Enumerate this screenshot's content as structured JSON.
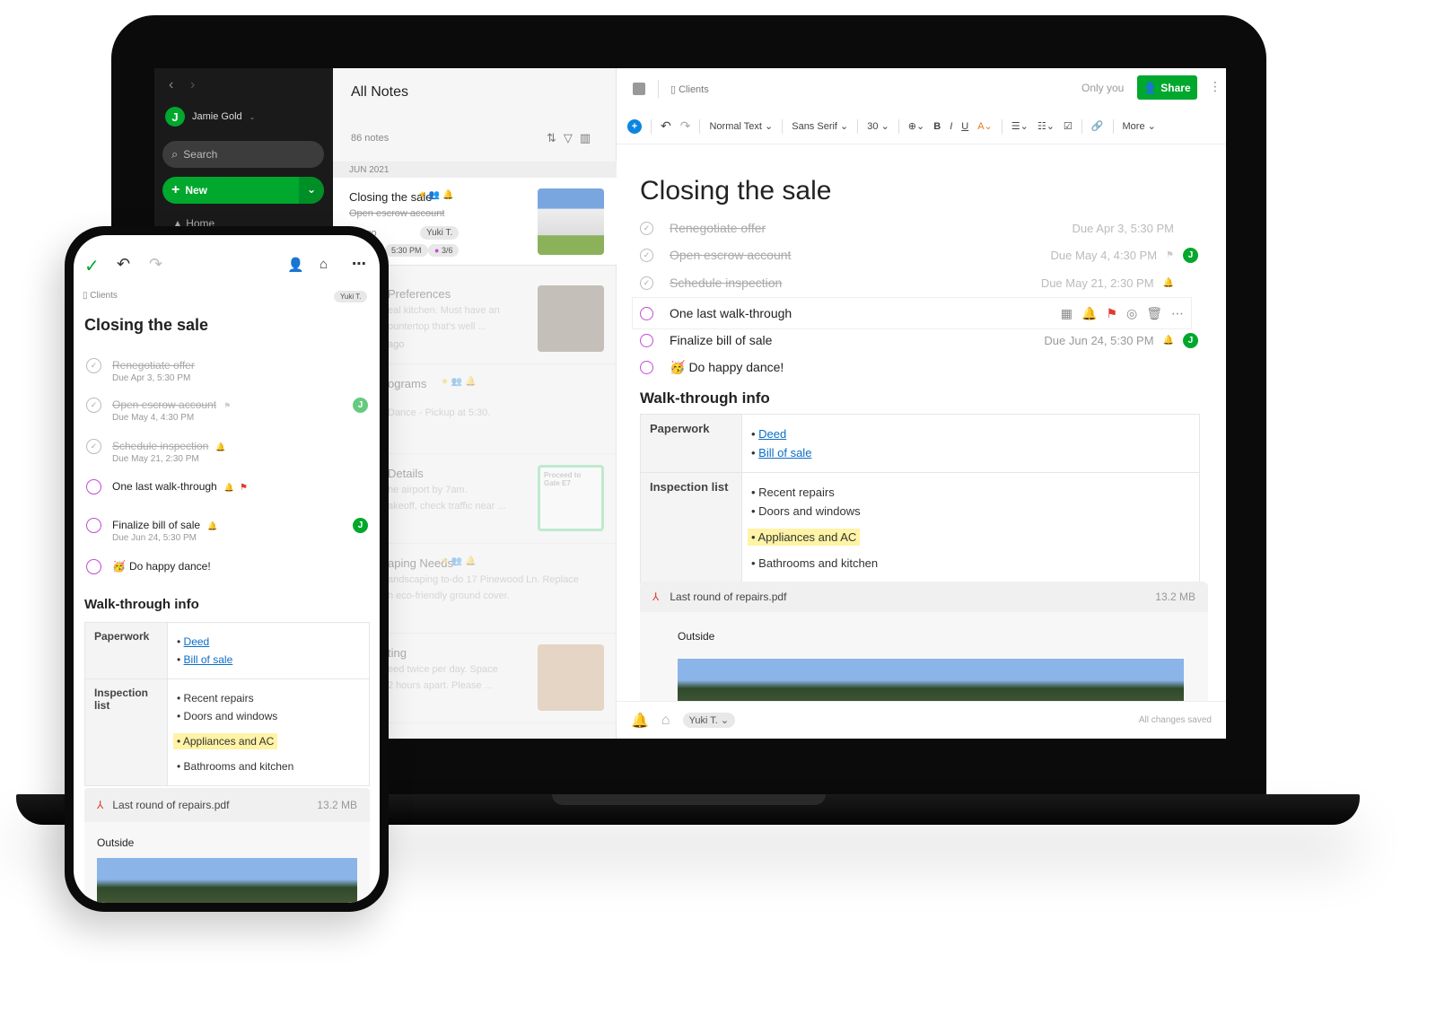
{
  "sidebar": {
    "user": "Jamie Gold",
    "avatar_initial": "J",
    "search_placeholder": "Search",
    "new_label": "New",
    "home_label": "Home"
  },
  "note_list": {
    "title": "All Notes",
    "count": "86 notes",
    "group": "JUN 2021",
    "notes": [
      {
        "title": "Closing the sale",
        "snippet": "Open escrow account",
        "time": "te ago",
        "user": "Yuki T.",
        "reminder": "5:30 PM",
        "tasks": "3/6"
      },
      {
        "title": "Preferences",
        "snippet": "eal kitchen. Must have an",
        "snippet2": "ountertop that's well ...",
        "time": "ago"
      },
      {
        "title": "ograms",
        "snippet": "Dance - Pickup at 5:30."
      },
      {
        "title": "Details",
        "snippet": "he airport by 7am.",
        "snippet2": "akeoff, check traffic near ...",
        "ticket": "Proceed to Gate E7"
      },
      {
        "title": "aping Needs",
        "snippet": "andscaping to-do 17 Pinewood Ln. Replace",
        "snippet2": "h eco-friendly ground cover."
      },
      {
        "title": "ting",
        "snippet": "eed twice per day. Space",
        "snippet2": "2 hours apart. Please ..."
      }
    ]
  },
  "editor": {
    "notebook": "Clients",
    "visibility": "Only you",
    "share_label": "Share",
    "toolbar": {
      "style": "Normal Text",
      "font": "Sans Serif",
      "size": "30",
      "more": "More"
    },
    "title": "Closing the sale",
    "tasks": [
      {
        "text": "Renegotiate offer",
        "done": true,
        "due": "Due Apr 3, 5:30 PM"
      },
      {
        "text": "Open escrow account",
        "done": true,
        "due": "Due May 4, 4:30 PM",
        "flag": true,
        "assignee": "J"
      },
      {
        "text": "Schedule inspection",
        "done": true,
        "due": "Due May 21, 2:30 PM",
        "bell": true
      },
      {
        "text": "One last walk-through",
        "done": false,
        "active": true
      },
      {
        "text": "Finalize bill of sale",
        "done": false,
        "due": "Due Jun 24, 5:30 PM",
        "bell": true,
        "assignee": "J"
      },
      {
        "text": "Do happy dance!",
        "done": false,
        "emoji": "🥳"
      }
    ],
    "section_heading": "Walk-through info",
    "table": {
      "paperwork_label": "Paperwork",
      "paperwork_links": [
        "Deed",
        "Bill of sale"
      ],
      "inspection_label": "Inspection list",
      "inspection_items": [
        "Recent repairs",
        "Doors and windows",
        "Appliances and AC",
        "Bathrooms and kitchen"
      ],
      "highlighted": "Appliances and AC"
    },
    "attachment": {
      "name": "Last round of repairs.pdf",
      "size": "13.2 MB",
      "caption": "Outside"
    },
    "footer": {
      "user": "Yuki T.",
      "status": "All changes saved"
    }
  },
  "phone": {
    "notebook": "Clients",
    "user": "Yuki T.",
    "title": "Closing the sale",
    "tasks": [
      {
        "text": "Renegotiate offer",
        "done": true,
        "due": "Due Apr 3, 5:30 PM"
      },
      {
        "text": "Open escrow account",
        "done": true,
        "due": "Due May 4, 4:30 PM",
        "flag": true,
        "assignee": "J"
      },
      {
        "text": "Schedule inspection",
        "done": true,
        "due": "Due May 21, 2:30 PM",
        "bell": true
      },
      {
        "text": "One last walk-through",
        "done": false,
        "bell": true,
        "redflag": true
      },
      {
        "text": "Finalize bill of sale",
        "done": false,
        "due": "Due Jun 24, 5:30 PM",
        "bell": true,
        "assignee": "J"
      },
      {
        "text": "Do happy dance!",
        "done": false,
        "emoji": "🥳"
      }
    ]
  },
  "colors": {
    "brand_green": "#00a82d",
    "accent_blue": "#0b6ec7",
    "task_purple": "#c34bd4",
    "highlight": "#fff3a6"
  }
}
